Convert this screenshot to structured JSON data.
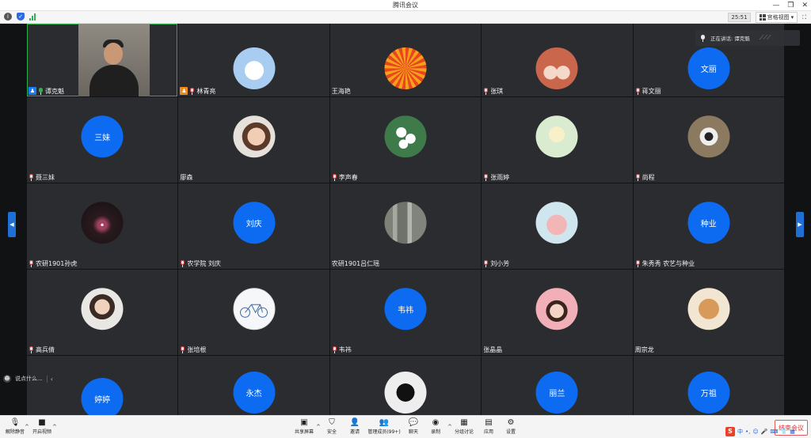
{
  "window": {
    "title": "腾讯会议"
  },
  "infobar": {
    "timer": "25:51",
    "view_label": "宫格视图"
  },
  "speaking": {
    "label": "正在讲话: 谭克魁"
  },
  "participants": [
    {
      "name": "谭克魁",
      "avatar_text": "",
      "badge": "host"
    },
    {
      "name": "林青亮",
      "avatar_text": "",
      "badge": "cohost"
    },
    {
      "name": "王海艳",
      "avatar_text": "",
      "badge": ""
    },
    {
      "name": "张琪",
      "avatar_text": "",
      "badge": ""
    },
    {
      "name": "蒋文丽",
      "avatar_text": "文丽",
      "badge": ""
    },
    {
      "name": "聂三妹",
      "avatar_text": "三妹",
      "badge": ""
    },
    {
      "name": "廖森",
      "avatar_text": "",
      "badge": ""
    },
    {
      "name": "李声春",
      "avatar_text": "",
      "badge": ""
    },
    {
      "name": "张雨婷",
      "avatar_text": "",
      "badge": ""
    },
    {
      "name": "尚程",
      "avatar_text": "",
      "badge": ""
    },
    {
      "name": "农研1901孙虎",
      "avatar_text": "",
      "badge": ""
    },
    {
      "name": "农学院 刘庆",
      "avatar_text": "刘庆",
      "badge": ""
    },
    {
      "name": "农研1901吕仁瑶",
      "avatar_text": "",
      "badge": ""
    },
    {
      "name": "刘小芳",
      "avatar_text": "",
      "badge": ""
    },
    {
      "name": "朱秀秀 农艺与种业",
      "avatar_text": "种业",
      "badge": ""
    },
    {
      "name": "高兵倩",
      "avatar_text": "",
      "badge": ""
    },
    {
      "name": "张培根",
      "avatar_text": "",
      "badge": ""
    },
    {
      "name": "韦祎",
      "avatar_text": "韦祎",
      "badge": ""
    },
    {
      "name": "张晶晶",
      "avatar_text": "",
      "badge": ""
    },
    {
      "name": "周宗龙",
      "avatar_text": "",
      "badge": ""
    },
    {
      "name": "",
      "avatar_text": "婷婷",
      "badge": ""
    },
    {
      "name": "",
      "avatar_text": "永杰",
      "badge": ""
    },
    {
      "name": "",
      "avatar_text": "",
      "badge": ""
    },
    {
      "name": "",
      "avatar_text": "丽兰",
      "badge": ""
    },
    {
      "name": "",
      "avatar_text": "万祖",
      "badge": ""
    }
  ],
  "chat": {
    "placeholder": "说点什么..."
  },
  "toolbar": {
    "mute": "解除静音",
    "video": "开启视频",
    "share": "共享屏幕",
    "security": "安全",
    "invite": "邀请",
    "members": "管理成员(99+)",
    "chat": "聊天",
    "record": "录制",
    "breakout": "分组讨论",
    "apps": "应用",
    "settings": "设置",
    "end": "结束会议"
  },
  "ime": {
    "logo": "S",
    "lang": "中"
  },
  "colors": {
    "accent": "#0d6bf2",
    "tile_bg": "#2b2c30",
    "speaking": "#2eb14e",
    "end": "#d33333"
  }
}
